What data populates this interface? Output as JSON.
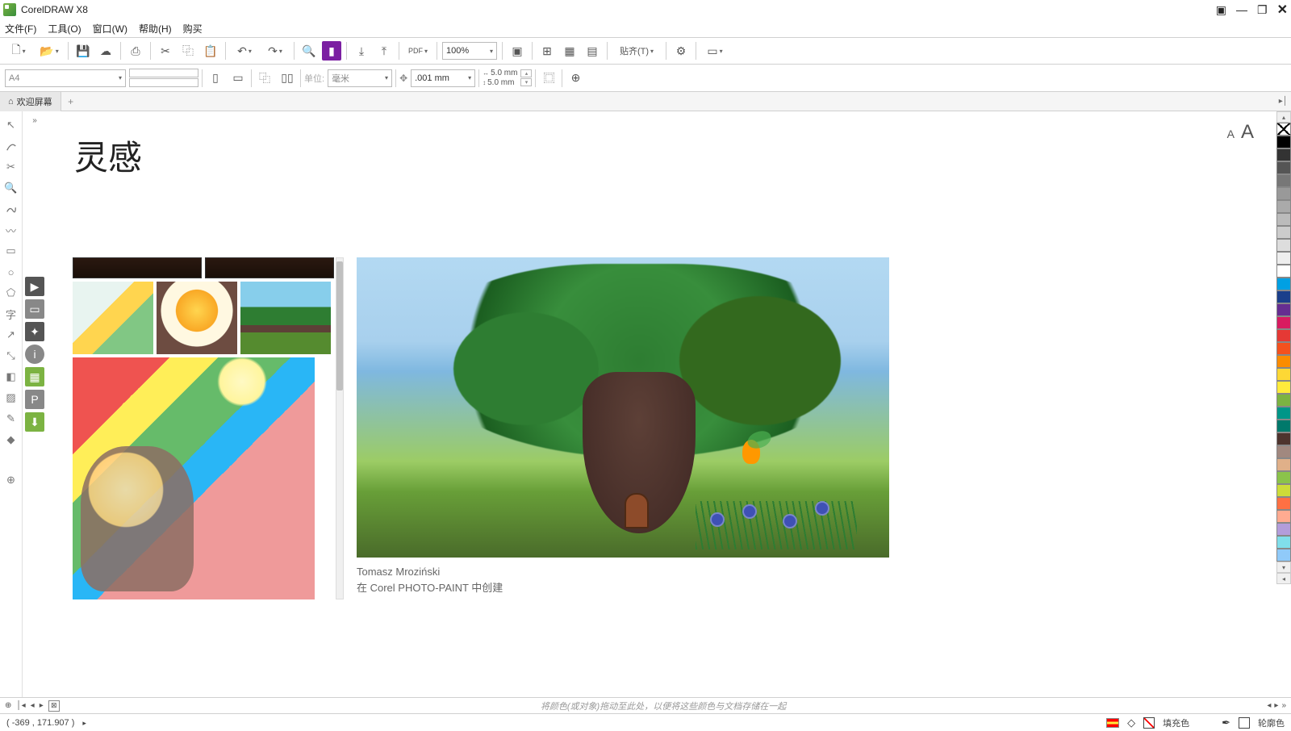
{
  "app": {
    "title": "CorelDRAW X8"
  },
  "menu": {
    "file": "文件(F)",
    "tools": "工具(O)",
    "window": "窗口(W)",
    "help": "帮助(H)",
    "buy": "购买"
  },
  "toolbar": {
    "zoom": "100%",
    "align_label": "贴齐(T)"
  },
  "props": {
    "page_size": "A4",
    "unit_label": "单位:",
    "unit_value": "毫米",
    "nudge": ".001 mm",
    "dup_x": "5.0 mm",
    "dup_y": "5.0 mm"
  },
  "tabs": {
    "welcome": "欢迎屏幕"
  },
  "content": {
    "heading": "灵感",
    "artist": "Tomasz Mroziński",
    "created_in": "在 Corel PHOTO-PAINT 中创建"
  },
  "palette_colors": [
    "#000000",
    "#333333",
    "#555555",
    "#777777",
    "#999999",
    "#aaaaaa",
    "#bbbbbb",
    "#cccccc",
    "#dddddd",
    "#eeeeee",
    "#ffffff",
    "#00a0e3",
    "#1b3f8b",
    "#662d91",
    "#d81b60",
    "#e53935",
    "#f4511e",
    "#fb8c00",
    "#fdd835",
    "#ffeb3b",
    "#7cb342",
    "#009688",
    "#00796b",
    "#4e342e",
    "#a1887f",
    "#e0b089",
    "#8bc34a",
    "#cddc39",
    "#ff7043",
    "#ffab91",
    "#b39ddb",
    "#80deea",
    "#90caf9"
  ],
  "bottom": {
    "hint": "将颜色(或对象)拖动至此处，以便将这些颜色与文档存储在一起"
  },
  "status": {
    "coords": "( -369 , 171.907 )",
    "fill_label": "填充色",
    "outline_label": "轮廓色"
  }
}
